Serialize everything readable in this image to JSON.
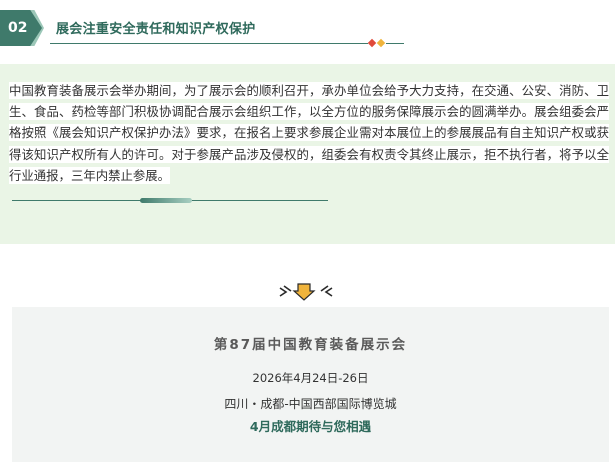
{
  "header": {
    "badge_number": "02",
    "title": "展会注重安全责任和知识产权保护",
    "accent_color": "#3f7a6b"
  },
  "content": {
    "paragraph": "中国教育装备展示会举办期间，为了展示会的顺利召开，承办单位会给予大力支持，在交通、公安、消防、卫生、食品、药检等部门积极协调配合展示会组织工作，以全方位的服务保障展示会的圆满举办。展会组委会严格按照《展会知识产权保护办法》要求，在报名上要求参展企业需对本展位上的参展展品有自主知识产权或获得该知识产权所有人的许可。对于参展产品涉及侵权的，组委会有权责令其终止展示，拒不执行者，将予以全行业通报，三年内禁止参展。",
    "background_color": "#eaf5e6"
  },
  "ornament": {
    "icon": "down-arrow-icon",
    "arrow_color": "#f0b43c"
  },
  "expo": {
    "title": "第87届中国教育装备展示会",
    "date": "2026年4月24日-26日",
    "venue": "四川・成都-中国西部国际博览城",
    "slogan": "4月成都期待与您相遇"
  }
}
